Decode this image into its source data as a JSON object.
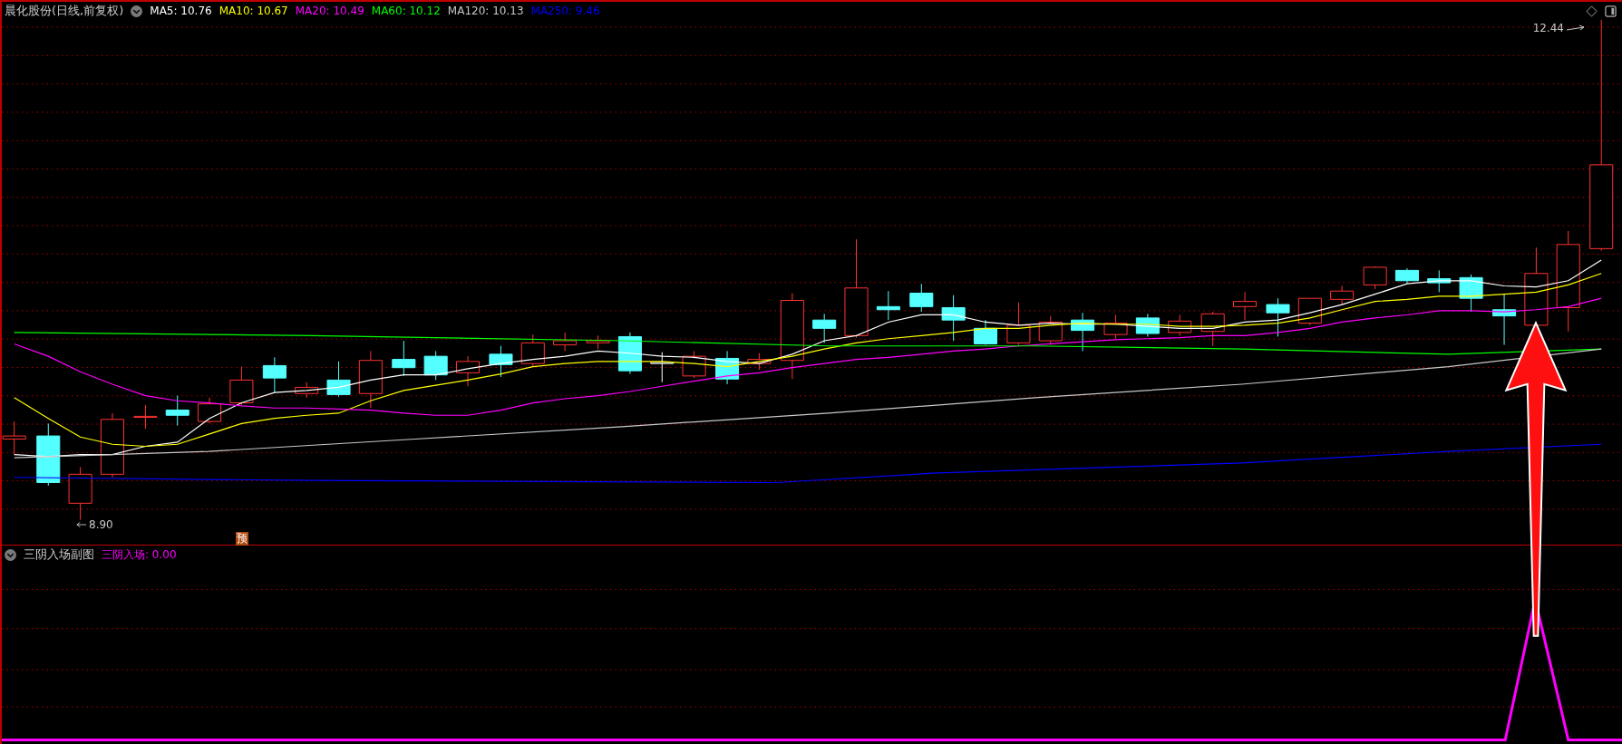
{
  "main_panel": {
    "title": "晨化股份(日线,前复权)",
    "indicators": [
      {
        "label": "MA5: 10.76",
        "color": "#ffffff"
      },
      {
        "label": "MA10: 10.67",
        "color": "#ffff00"
      },
      {
        "label": "MA20: 10.49",
        "color": "#ff00ff"
      },
      {
        "label": "MA60: 10.12",
        "color": "#00ff00"
      },
      {
        "label": "MA120: 10.13",
        "color": "#c8c8c8"
      },
      {
        "label": "MA250: 9.46",
        "color": "#0000ff"
      }
    ],
    "high_label": "12.44",
    "low_label": "8.90",
    "badge": "预"
  },
  "sub_panel": {
    "title": "三阴入场副图",
    "indicators": [
      {
        "label": "三阴入场: 0.00",
        "color": "#ff00ff"
      }
    ]
  }
}
